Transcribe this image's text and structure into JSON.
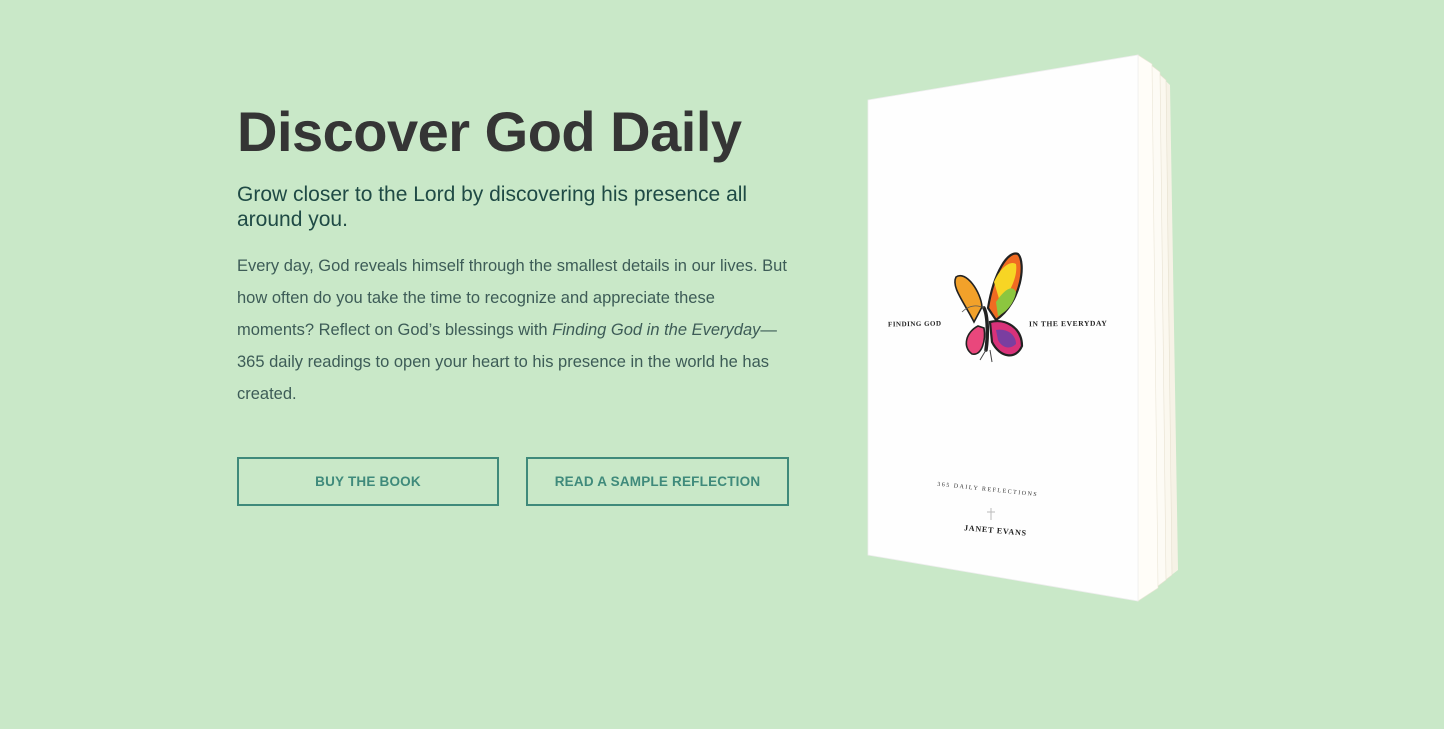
{
  "hero": {
    "headline": "Discover God Daily",
    "subheadline": "Grow closer to the Lord by discovering his presence all around you.",
    "body_before": "Every day, God reveals himself through the smallest details in our lives. But how often do you take the time to recognize and appreciate these moments? Reflect on God’s blessings with ",
    "body_italic": "Finding God in the Everyday",
    "body_after": "—365 daily readings to open your heart to his presence in the world he has created."
  },
  "buttons": {
    "buy_label": "BUY THE BOOK",
    "sample_label": "READ A SAMPLE REFLECTION"
  },
  "book": {
    "title_left": "FINDING GOD",
    "title_right": "IN THE EVERYDAY",
    "tagline": "365 DAILY REFLECTIONS",
    "author": "JANET EVANS",
    "icon": "butterfly-icon"
  },
  "colors": {
    "background": "#c9e8c8",
    "headline": "#353535",
    "accent": "#3f8a7b"
  }
}
